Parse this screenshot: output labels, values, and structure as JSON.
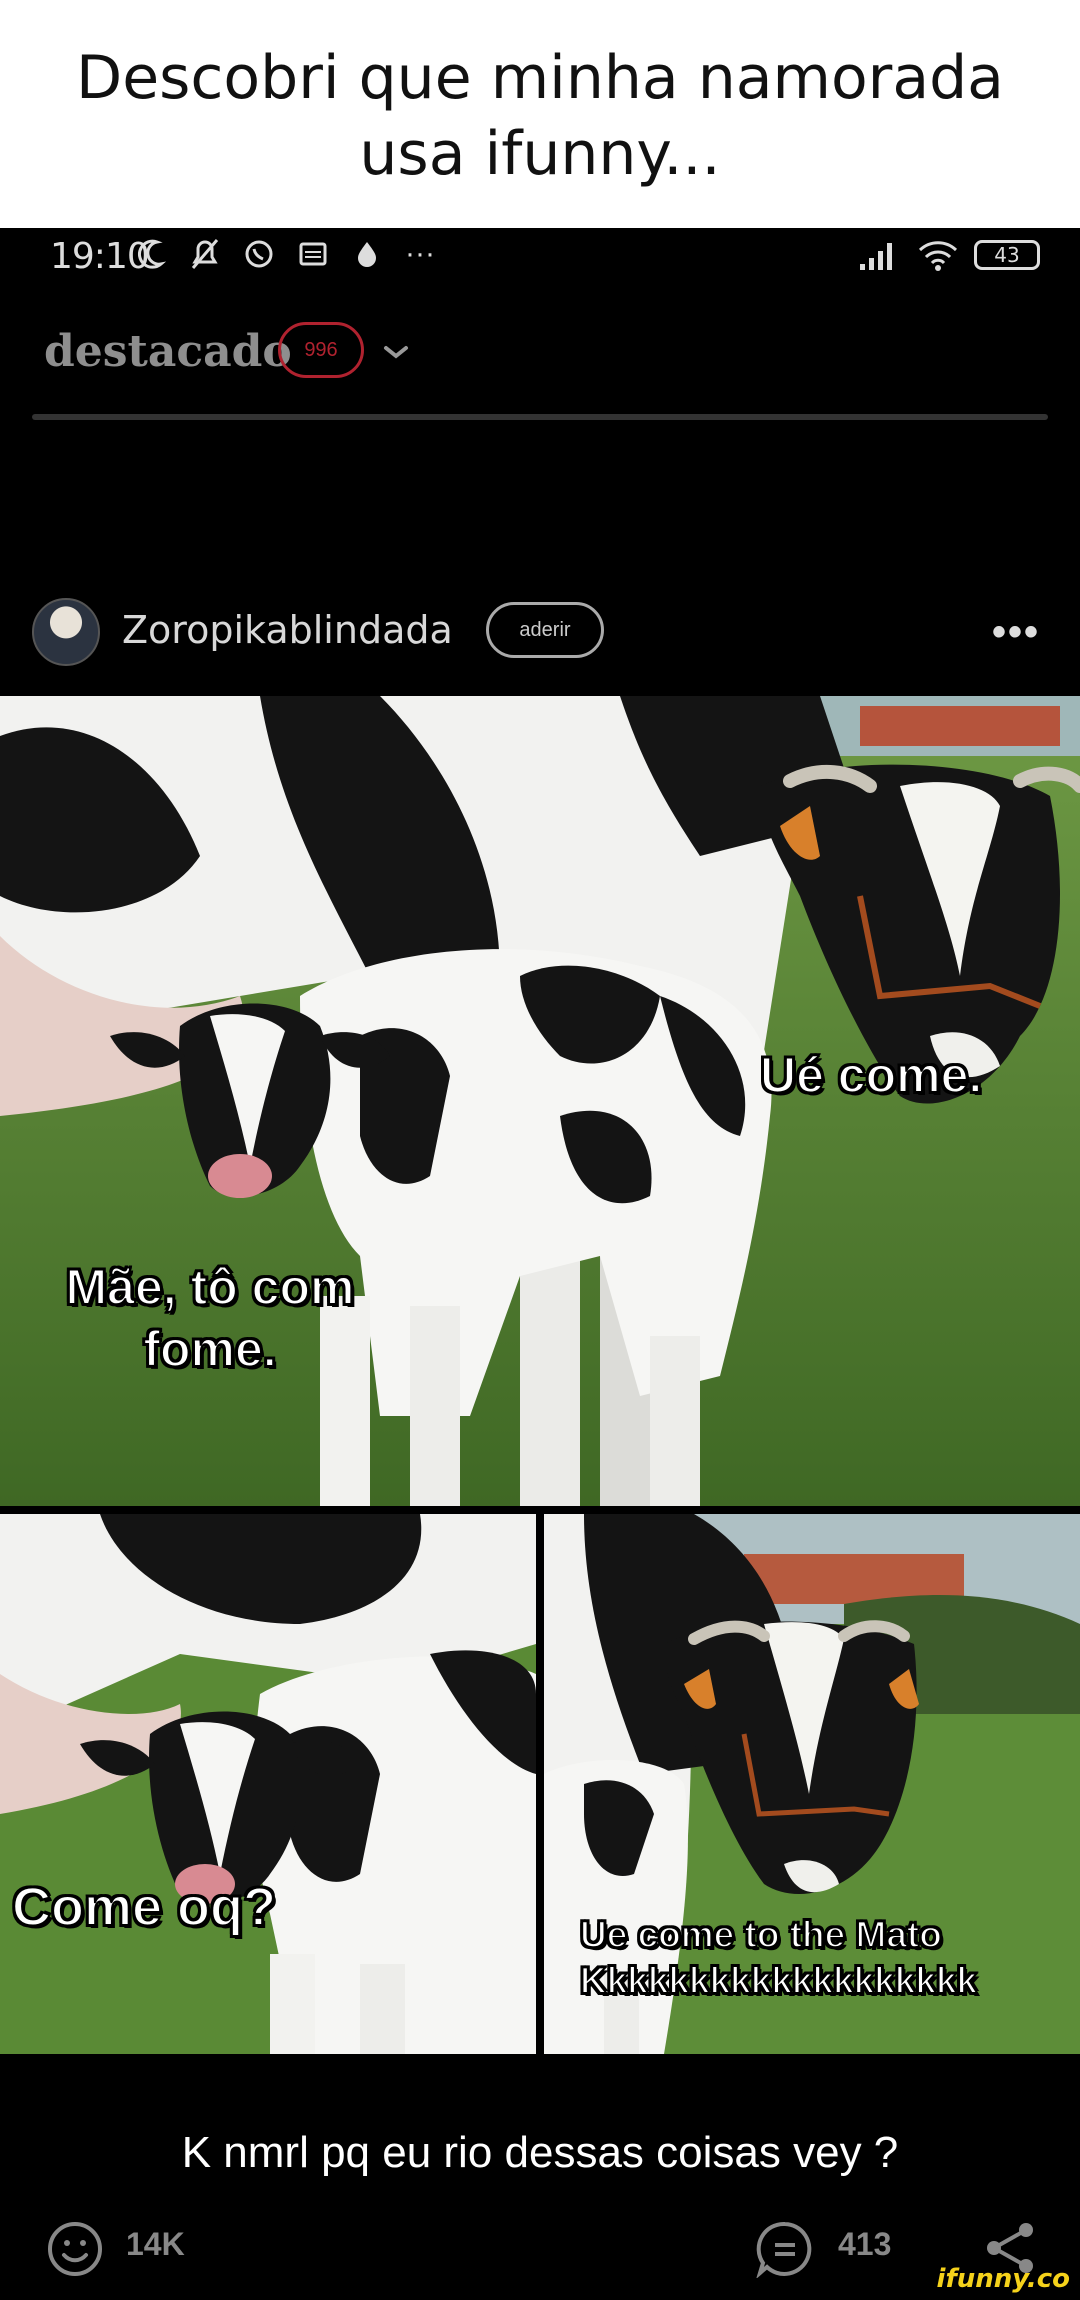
{
  "caption": {
    "line1": "Descobri que minha namorada",
    "line2": "usa ifunny..."
  },
  "status_bar": {
    "time": "19:10",
    "battery": "43",
    "more": "···",
    "icons": [
      "moon-icon",
      "mute-icon",
      "whatsapp-icon",
      "message-icon",
      "drop-icon",
      "signal-icon",
      "wifi-icon",
      "battery-icon"
    ]
  },
  "feed": {
    "title": "destacado",
    "badge": "996"
  },
  "post": {
    "username": "Zoropikablindada",
    "join_label": "aderir",
    "more_label": "•••"
  },
  "meme": {
    "panel1_calf": "Mãe, tô com\nfome.",
    "panel1_cow": "Ué come.",
    "panel2_calf": "Come oq?",
    "panel3_line1": "Ue come to the Mato",
    "panel3_line2": "Kkkkkkkkkkkkkkkkkkk"
  },
  "bottom": {
    "caption": "K nmrl pq eu rio dessas coisas vey ?",
    "likes": "14K",
    "comments": "413",
    "watermark": "ifunny.co"
  },
  "colors": {
    "background": "#000000",
    "badge": "#b0222f",
    "grass": "#4f7a2e",
    "watermark": "#f5d21b"
  }
}
